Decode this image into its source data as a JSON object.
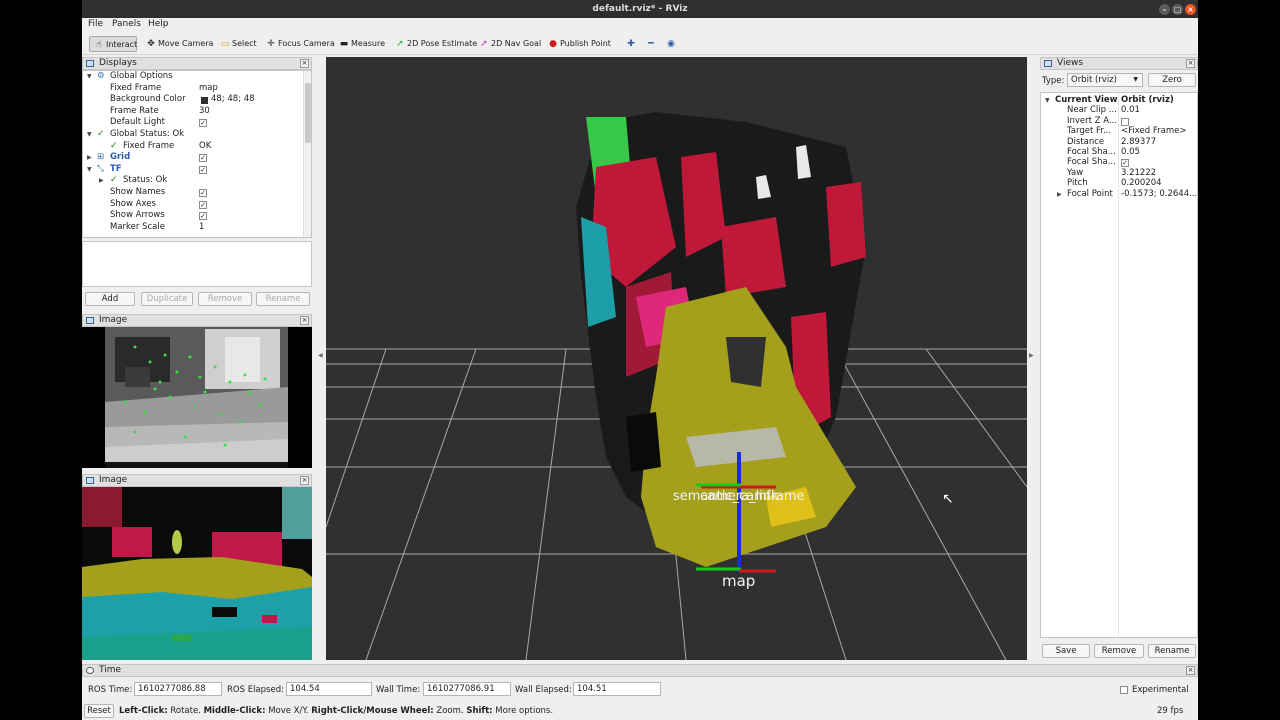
{
  "window": {
    "title": "default.rviz* - RViz"
  },
  "menubar": {
    "items": [
      "File",
      "Panels",
      "Help"
    ]
  },
  "toolbar": {
    "tools": [
      {
        "label": "Interact",
        "icon": "cursor-icon"
      },
      {
        "label": "Move Camera",
        "icon": "move-camera-icon"
      },
      {
        "label": "Select",
        "icon": "select-box-icon"
      },
      {
        "label": "Focus Camera",
        "icon": "focus-camera-icon"
      },
      {
        "label": "Measure",
        "icon": "ruler-icon"
      },
      {
        "label": "2D Pose Estimate",
        "icon": "pose-estimate-arrow-icon"
      },
      {
        "label": "2D Nav Goal",
        "icon": "nav-goal-arrow-icon"
      },
      {
        "label": "Publish Point",
        "icon": "map-pin-icon"
      }
    ],
    "active": "Interact"
  },
  "displays": {
    "title": "Displays",
    "rows": [
      {
        "key": "Global Options",
        "value": ""
      },
      {
        "key": "Fixed Frame",
        "value": "map"
      },
      {
        "key": "Background Color",
        "value": "48; 48; 48"
      },
      {
        "key": "Frame Rate",
        "value": "30"
      },
      {
        "key": "Default Light",
        "value": "✓"
      },
      {
        "key": "Global Status: Ok",
        "value": ""
      },
      {
        "key": "Fixed Frame",
        "value": "OK"
      },
      {
        "key": "Grid",
        "value": "✓"
      },
      {
        "key": "TF",
        "value": "✓"
      },
      {
        "key": "Status: Ok",
        "value": ""
      },
      {
        "key": "Show Names",
        "value": "✓"
      },
      {
        "key": "Show Axes",
        "value": "✓"
      },
      {
        "key": "Show Arrows",
        "value": "✓"
      },
      {
        "key": "Marker Scale",
        "value": "1"
      }
    ],
    "background_color_hex": "#303030",
    "buttons": {
      "add": "Add",
      "duplicate": "Duplicate",
      "remove": "Remove",
      "rename": "Rename"
    }
  },
  "image_panels": [
    {
      "title": "Image"
    },
    {
      "title": "Image"
    }
  ],
  "views": {
    "title": "Views",
    "type_label": "Type:",
    "type_value": "Orbit (rviz)",
    "zero_label": "Zero",
    "current_view_key": "Current View",
    "current_view_value": "Orbit (rviz)",
    "props": [
      {
        "key": "Near Clip ...",
        "value": "0.01"
      },
      {
        "key": "Invert Z A...",
        "value": ""
      },
      {
        "key": "Target Fr...",
        "value": "<Fixed Frame>"
      },
      {
        "key": "Distance",
        "value": "2.89377"
      },
      {
        "key": "Focal Sha...",
        "value": "0.05"
      },
      {
        "key": "Focal Sha...",
        "value": "✓"
      },
      {
        "key": "Yaw",
        "value": "3.21222"
      },
      {
        "key": "Pitch",
        "value": "0.200204"
      },
      {
        "key": "Focal Point",
        "value": "-0.1573; 0.2644..."
      }
    ],
    "buttons": {
      "save": "Save",
      "remove": "Remove",
      "rename": "Rename"
    }
  },
  "viewport": {
    "frame_labels": {
      "semantic_cam": "semantic_cam",
      "camera_link": "camera_link",
      "frame": "frame",
      "map": "map"
    },
    "colors": {
      "floor": "#a4a01c",
      "walls_dark": "#1a1a1a",
      "crimson": "#c01838",
      "green": "#38c848",
      "teal": "#1e9fa8"
    }
  },
  "time_panel": {
    "title": "Time",
    "ros_time_label": "ROS Time:",
    "ros_time": "1610277086.88",
    "ros_elapsed_label": "ROS Elapsed:",
    "ros_elapsed": "104.54",
    "wall_time_label": "Wall Time:",
    "wall_time": "1610277086.91",
    "wall_elapsed_label": "Wall Elapsed:",
    "wall_elapsed": "104.51",
    "experimental_label": "Experimental"
  },
  "status": {
    "reset_label": "Reset",
    "hint_b1": "Left-Click:",
    "hint_t1": "Rotate.",
    "hint_b2": "Middle-Click:",
    "hint_t2": "Move X/Y.",
    "hint_b3": "Right-Click/Mouse Wheel:",
    "hint_t3": "Zoom.",
    "hint_b4": "Shift:",
    "hint_t4": "More options.",
    "fps": "29 fps"
  }
}
